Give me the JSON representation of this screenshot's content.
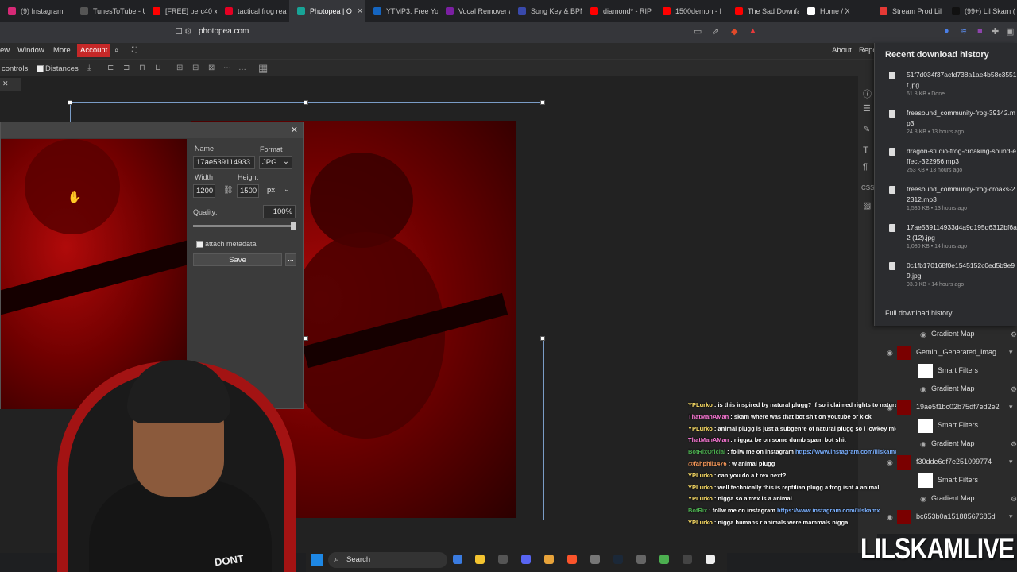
{
  "browser": {
    "tabs": [
      {
        "label": "(9) Instagram",
        "color": "#d62976"
      },
      {
        "label": "TunesToTube - U",
        "color": "#555555"
      },
      {
        "label": "[FREE] perc40 x",
        "color": "#ff0000"
      },
      {
        "label": "tactical frog rea",
        "color": "#e60023"
      },
      {
        "label": "Photopea | O",
        "color": "#18a497",
        "active": true
      },
      {
        "label": "YTMP3: Free You",
        "color": "#1565c0"
      },
      {
        "label": "Vocal Remover a",
        "color": "#7b1fa2"
      },
      {
        "label": "Song Key & BPM",
        "color": "#3949ab"
      },
      {
        "label": "diamond* - RIP",
        "color": "#ff0000"
      },
      {
        "label": "1500demon - I",
        "color": "#ff0000"
      },
      {
        "label": "The Sad Downfa",
        "color": "#ff0000"
      },
      {
        "label": "Home / X",
        "color": "#ffffff"
      },
      {
        "label": "Stream Prod Lil",
        "color": "#e53935"
      },
      {
        "label": "(99+) Lil Skam (",
        "color": "#111111"
      }
    ],
    "close_glyph": "✕",
    "url": "photopea.com",
    "bookmark_icon": "bookmark-icon"
  },
  "photopea": {
    "menu": {
      "window": "Window",
      "more": "More",
      "account": "Account",
      "left_cut": "ew",
      "about": "About",
      "report": "Repo"
    },
    "toolbar": {
      "controls": "controls",
      "distances": "Distances"
    },
    "doc_tab_close": "✕"
  },
  "export_dialog": {
    "close_glyph": "✕",
    "name_label": "Name",
    "name_value": "17ae539114933",
    "format_label": "Format",
    "format_value": "JPG",
    "width_label": "Width",
    "height_label": "Height",
    "width_value": "1200",
    "height_value": "1500",
    "unit_value": "px",
    "quality_label": "Quality:",
    "quality_value": "100%",
    "quality_fraction": 1.0,
    "metadata_label": "attach metadata",
    "save_label": "Save",
    "more_label": "..."
  },
  "downloads": {
    "title": "Recent download history",
    "items": [
      {
        "name": "51f7d034f37acfd738a1ae4b58c3551f.jpg",
        "meta": "61.8 KB • Done"
      },
      {
        "name": "freesound_community-frog-39142.mp3",
        "meta": "24.8 KB • 13 hours ago"
      },
      {
        "name": "dragon-studio-frog-croaking-sound-effect-322956.mp3",
        "meta": "253 KB • 13 hours ago"
      },
      {
        "name": "freesound_community-frog-croaks-22312.mp3",
        "meta": "1,536 KB • 13 hours ago"
      },
      {
        "name": "17ae539114933d4a9d195d6312bf6a2 (12).jpg",
        "meta": "1,080 KB • 14 hours ago"
      },
      {
        "name": "0c1fb170168f0e1545152c0ed5b9e99.jpg",
        "meta": "93.9 KB • 14 hours ago"
      }
    ],
    "full_history": "Full download history"
  },
  "layers": [
    {
      "name": "Gradient Map",
      "indent": true
    },
    {
      "name": "Gemini_Generated_Imag",
      "indent": false
    },
    {
      "name": "Smart Filters",
      "indent": true
    },
    {
      "name": "Gradient Map",
      "indent": true
    },
    {
      "name": "19ae5f1bc02b75df7ed2e2",
      "indent": false
    },
    {
      "name": "Smart Filters",
      "indent": true
    },
    {
      "name": "Gradient Map",
      "indent": true
    },
    {
      "name": "f30dde6df7e25109977​4",
      "indent": false
    },
    {
      "name": "Smart Filters",
      "indent": true
    },
    {
      "name": "Gradient Map",
      "indent": true
    },
    {
      "name": "bc653b0a15188567685d",
      "indent": false
    }
  ],
  "chat": [
    {
      "user": "YPLurko",
      "color": "#ffe066",
      "text": "is this inspired by natural plugg? if so i claimed rights to natural plugg so u might get sued"
    },
    {
      "user": "ThatManAMan",
      "color": "#ff7ad9",
      "text": "skam where was that bot shit on youtube or kick"
    },
    {
      "user": "YPLurko",
      "color": "#ffe066",
      "text": "animal plugg is just a subgenre of natural plugg so i lowkey might sue everyone"
    },
    {
      "user": "ThatManAMan",
      "color": "#ff7ad9",
      "text": "niggaz be on some dumb spam bot shit"
    },
    {
      "user": "BotRixOficial",
      "color": "#4caf50",
      "text": "follw me on instagram ",
      "link": "https://www.instagram.com/lilskamx"
    },
    {
      "user": "@fahphil1476",
      "color": "#ff9d5c",
      "text": "w animal plugg"
    },
    {
      "user": "YPLurko",
      "color": "#ffe066",
      "text": "can you do a t rex next?"
    },
    {
      "user": "YPLurko",
      "color": "#ffe066",
      "text": "well technically this is reptilian plugg a frog isnt a animal"
    },
    {
      "user": "YPLurko",
      "color": "#ffe066",
      "text": "nigga so a trex is a animal"
    },
    {
      "user": "BotRix",
      "color": "#4caf50",
      "text": "follw me on instagram ",
      "link": "https://www.instagram.com/lilskamx"
    },
    {
      "user": "YPLurko",
      "color": "#ffe066",
      "text": "nigga humans r animals were mammals nigga"
    }
  ],
  "taskbar": {
    "search": "Search"
  },
  "webcam": {
    "shirt_text": "DONT"
  },
  "watermark": "LILSKAMLIVE"
}
